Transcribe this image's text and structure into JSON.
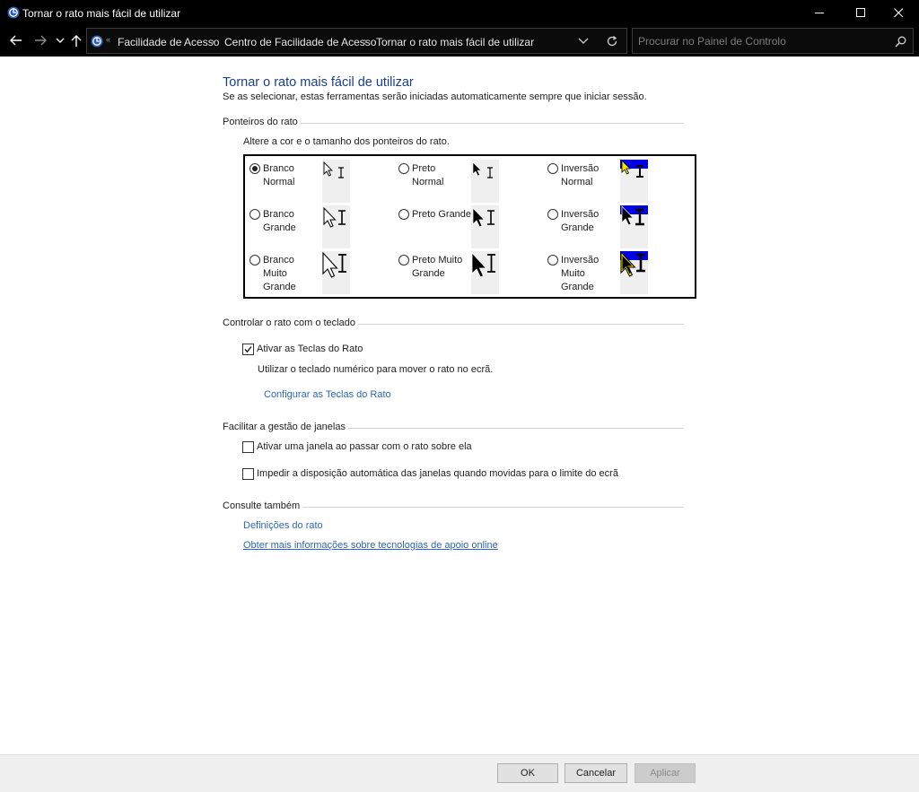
{
  "window": {
    "title": "Tornar o rato mais fácil de utilizar"
  },
  "address": {
    "breadcrumbs": [
      "Facilidade de Acesso",
      "Centro de Facilidade de Acesso",
      "Tornar o rato mais fácil de utilizar"
    ],
    "search_placeholder": "Procurar no Painel de Controlo"
  },
  "page": {
    "title": "Tornar o rato mais fácil de utilizar",
    "subtitle": "Se as selecionar, estas ferramentas serão iniciadas automaticamente sempre que iniciar sessão."
  },
  "pointers": {
    "heading": "Ponteiros do rato",
    "description": "Altere a cor e o tamanho dos ponteiros do rato.",
    "options": [
      {
        "label": "Branco\nNormal",
        "checked": true
      },
      {
        "label": "Preto\nNormal",
        "checked": false
      },
      {
        "label": "Inversão\nNormal",
        "checked": false
      },
      {
        "label": "Branco\nGrande",
        "checked": false
      },
      {
        "label": "Preto Grande",
        "checked": false
      },
      {
        "label": "Inversão\nGrande",
        "checked": false
      },
      {
        "label": "Branco\nMuito\nGrande",
        "checked": false
      },
      {
        "label": "Preto Muito\nGrande",
        "checked": false
      },
      {
        "label": "Inversão\nMuito\nGrande",
        "checked": false
      }
    ],
    "colors": {
      "inversion_bg": "#0000e6",
      "inversion_highlight": "#f5e600"
    }
  },
  "keyboard": {
    "heading": "Controlar o rato com o teclado",
    "mouse_keys_label": "Ativar as Teclas do Rato",
    "mouse_keys_checked": true,
    "mouse_keys_description": "Utilizar o teclado numérico para mover o rato no ecrã.",
    "configure_link": "Configurar as Teclas do Rato"
  },
  "windows": {
    "heading": "Facilitar a gestão de janelas",
    "hover_activate_label": "Ativar uma janela ao passar com o rato sobre ela",
    "hover_activate_checked": false,
    "prevent_snap_label": "Impedir a disposição automática das janelas quando movidas para o limite do ecrã",
    "prevent_snap_checked": false
  },
  "see_also": {
    "heading": "Consulte também",
    "links": [
      "Definições do rato",
      "Obter mais informações sobre tecnologias de apoio online"
    ]
  },
  "buttons": {
    "ok": "OK",
    "cancel": "Cancelar",
    "apply": "Aplicar"
  }
}
